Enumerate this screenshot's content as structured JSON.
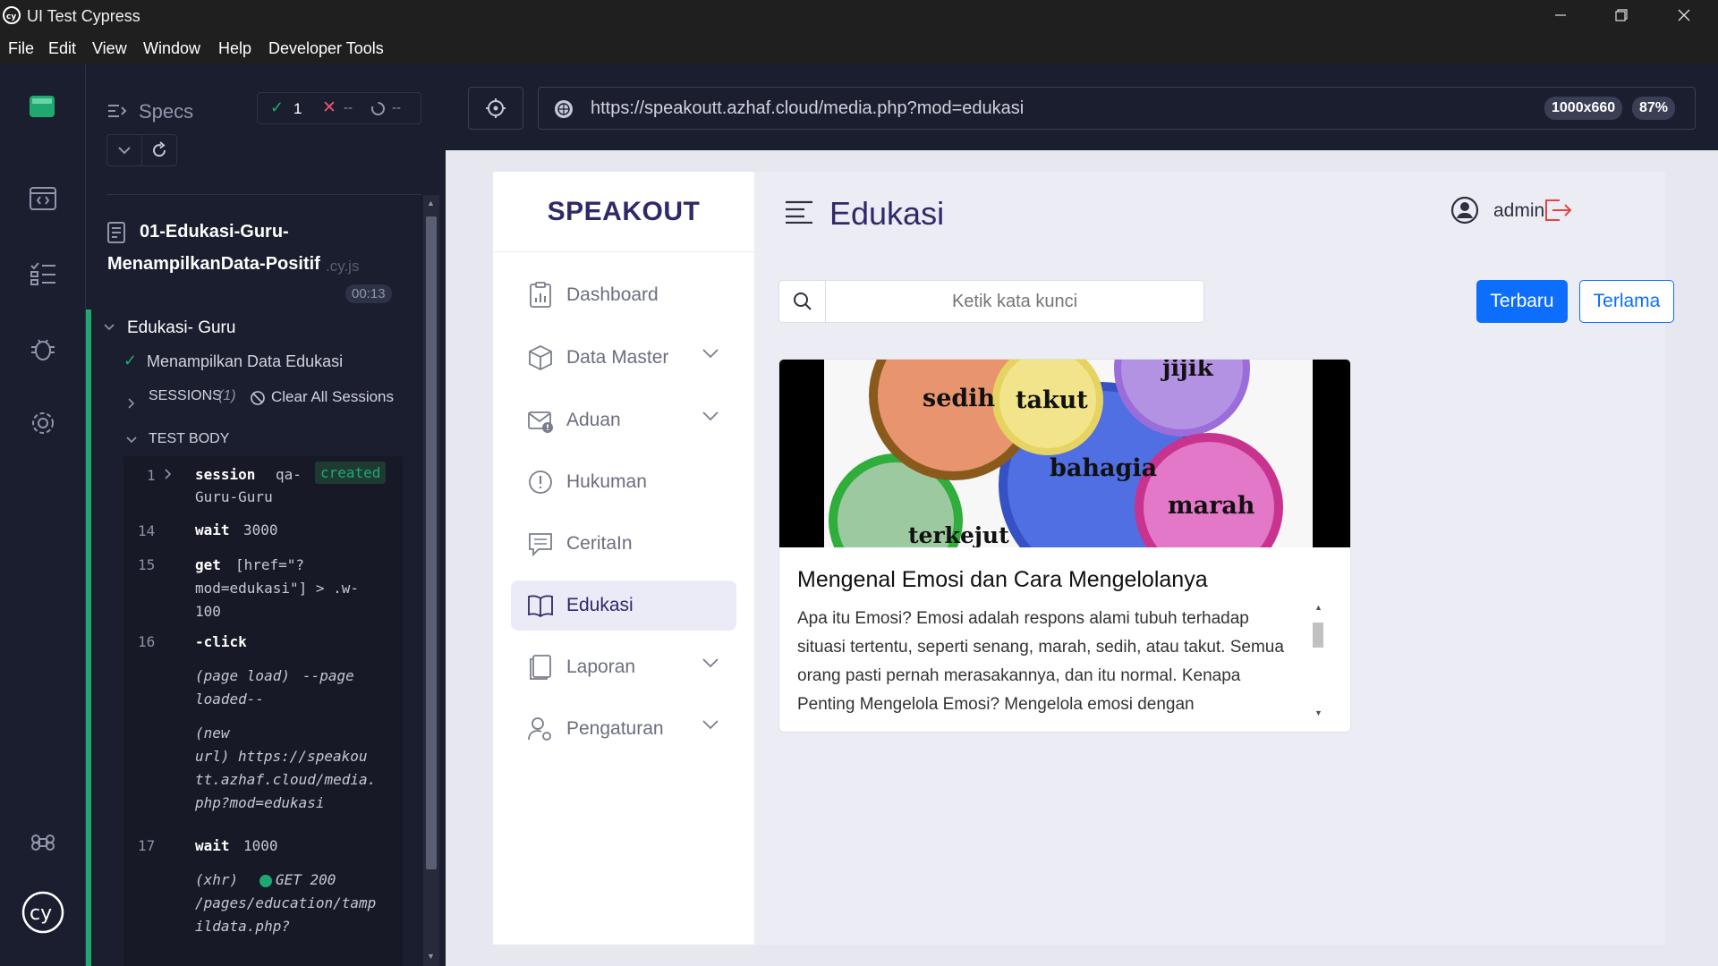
{
  "window": {
    "title": "UI Test Cypress",
    "menu": [
      "File",
      "Edit",
      "View",
      "Window",
      "Help",
      "Developer Tools"
    ]
  },
  "rail": {
    "icons": [
      "runner-logo-icon",
      "specs-icon",
      "runs-icon",
      "debug-icon",
      "settings-icon",
      "keyboard-shortcuts-icon",
      "cypress-logo-icon"
    ]
  },
  "specs_header": {
    "label": "Specs",
    "passed": "1",
    "failed": "--",
    "pending": "--"
  },
  "spec": {
    "name_line1": "01-Edukasi-Guru-",
    "name_line2": "MenampilkanData-Positif",
    "ext": ".cy.js",
    "duration": "00:13"
  },
  "suite": {
    "title": "Edukasi- Guru",
    "test_title": "Menampilkan Data Edukasi",
    "sessions_label": "SESSIONS",
    "sessions_count": "(1)",
    "clear_sessions": "Clear All Sessions",
    "test_body": "TEST BODY"
  },
  "commands": [
    {
      "num": "1",
      "name": "session",
      "msg": "qa-",
      "msg2": "Guru-Guru",
      "badge": "created"
    },
    {
      "num": "14",
      "name": "wait",
      "msg": "3000"
    },
    {
      "num": "15",
      "name": "get",
      "msg": "[href=\"?",
      "msg2": "mod=edukasi\"] > .w-",
      "msg3": "100"
    },
    {
      "num": "16",
      "name": "-click"
    },
    {
      "event": "(page load)",
      "msg": "--page",
      "msg2": "loaded--"
    },
    {
      "event": "(new",
      "event2": "url)",
      "msg": "https://speakou",
      "msg2": "tt.azhaf.cloud/media.",
      "msg3": "php?mod=edukasi"
    },
    {
      "num": "17",
      "name": "wait",
      "msg": "1000"
    },
    {
      "event": "(xhr)",
      "msg": "GET 200",
      "msg2": "/pages/education/tamp",
      "msg3": "ildata.php?"
    }
  ],
  "browser": {
    "url": "https://speakoutt.azhaf.cloud/media.php?mod=edukasi",
    "viewport": "1000x660",
    "zoom": "87%"
  },
  "app": {
    "brand": "SPEAKOUT",
    "nav": [
      {
        "label": "Dashboard",
        "icon": "dashboard-icon",
        "chevron": false
      },
      {
        "label": "Data Master",
        "icon": "box-icon",
        "chevron": true
      },
      {
        "label": "Aduan",
        "icon": "mail-alert-icon",
        "chevron": true
      },
      {
        "label": "Hukuman",
        "icon": "exclamation-circle-icon",
        "chevron": false
      },
      {
        "label": "CeritaIn",
        "icon": "chat-icon",
        "chevron": false
      },
      {
        "label": "Edukasi",
        "icon": "book-icon",
        "chevron": false,
        "active": true
      },
      {
        "label": "Laporan",
        "icon": "report-icon",
        "chevron": true
      },
      {
        "label": "Pengaturan",
        "icon": "user-settings-icon",
        "chevron": true
      }
    ],
    "page_title": "Edukasi",
    "user": "admin",
    "search_placeholder": "Ketik kata kunci",
    "btn_newest": "Terbaru",
    "btn_oldest": "Terlama",
    "card": {
      "emotions": [
        "sedih",
        "takut",
        "jijik",
        "bahagia",
        "marah",
        "terkejut"
      ],
      "title": "Mengenal Emosi dan Cara Mengelolanya",
      "body": "Apa itu Emosi? Emosi adalah respons alami tubuh terhadap situasi tertentu, seperti senang, marah, sedih, atau takut. Semua orang pasti pernah merasakannya, dan itu normal. Kenapa Penting Mengelola Emosi? Mengelola emosi dengan"
    }
  },
  "colors": {
    "accent": "#0d6efd",
    "brand": "#2e2968",
    "pass": "#1fa971",
    "fail": "#e45770"
  }
}
